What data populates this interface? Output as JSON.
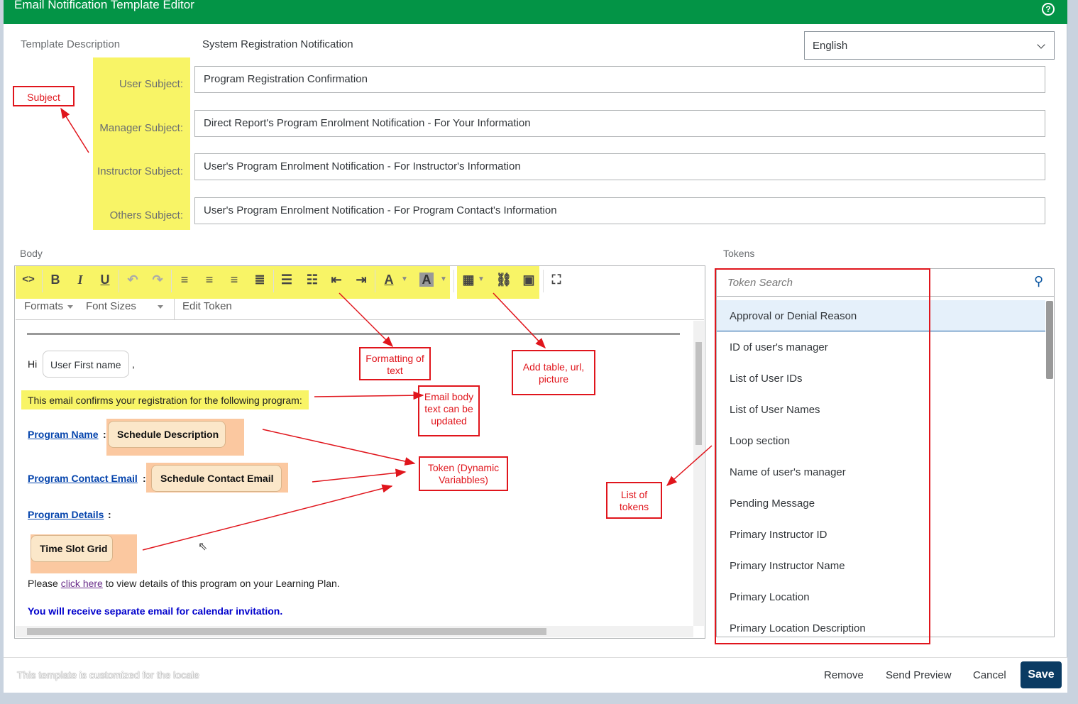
{
  "window": {
    "title": "Email Notification Template Editor"
  },
  "header": {
    "template_description_label": "Template Description",
    "template_description_value": "System Registration Notification",
    "language": "English"
  },
  "subjects": [
    {
      "label": "User Subject:",
      "value": "Program Registration Confirmation"
    },
    {
      "label": "Manager Subject:",
      "value": "Direct Report's Program Enrolment Notification - For Your Information"
    },
    {
      "label": "Instructor Subject:",
      "value": "User's Program Enrolment Notification - For Instructor's Information"
    },
    {
      "label": "Others Subject:",
      "value": "User's Program Enrolment Notification - For Program Contact's Information"
    }
  ],
  "body": {
    "label": "Body",
    "toolbar2": {
      "formats": "Formats",
      "font_sizes": "Font Sizes",
      "edit_token": "Edit Token"
    },
    "greeting": "Hi",
    "first_name_token": "User First name",
    "comma": ",",
    "confirm_line": "This email confirms your registration for the following program:",
    "program_name_label": "Program Name",
    "program_name_token": "Schedule Description",
    "contact_label": "Program Contact Email",
    "contact_token": "Schedule Contact Email",
    "details_label": "Program Details",
    "colon": ":",
    "time_slot_token": "Time Slot Grid",
    "please_pre": "Please",
    "click_here": "click here",
    "please_post": "to view details of this program on your Learning Plan.",
    "calendar_line": "You will receive separate email for calendar invitation."
  },
  "tokens": {
    "label": "Tokens",
    "search_placeholder": "Token Search",
    "items": [
      "Approval or Denial Reason",
      "ID of user's manager",
      "List of User IDs",
      "List of User Names",
      "Loop section",
      "Name of user's manager",
      "Pending Message",
      "Primary Instructor ID",
      "Primary Instructor Name",
      "Primary Location",
      "Primary Location Description"
    ]
  },
  "annotations": {
    "subject": "Subject",
    "formatting": "Formatting of text",
    "add_table": "Add table, url, picture",
    "email_body": "Email body text can be updated",
    "token_dynamic": "Token (Dynamic Variabbles)",
    "list_tokens": "List of tokens"
  },
  "footer": {
    "locale_note": "This template is customized for the locale",
    "remove": "Remove",
    "send_preview": "Send Preview",
    "cancel": "Cancel",
    "save": "Save"
  },
  "colors": {
    "titlebar": "#039446",
    "highlight": "#f8f466",
    "token_bg": "#fbc8a0",
    "annotation": "#e0151c",
    "save": "#0a3b63"
  }
}
